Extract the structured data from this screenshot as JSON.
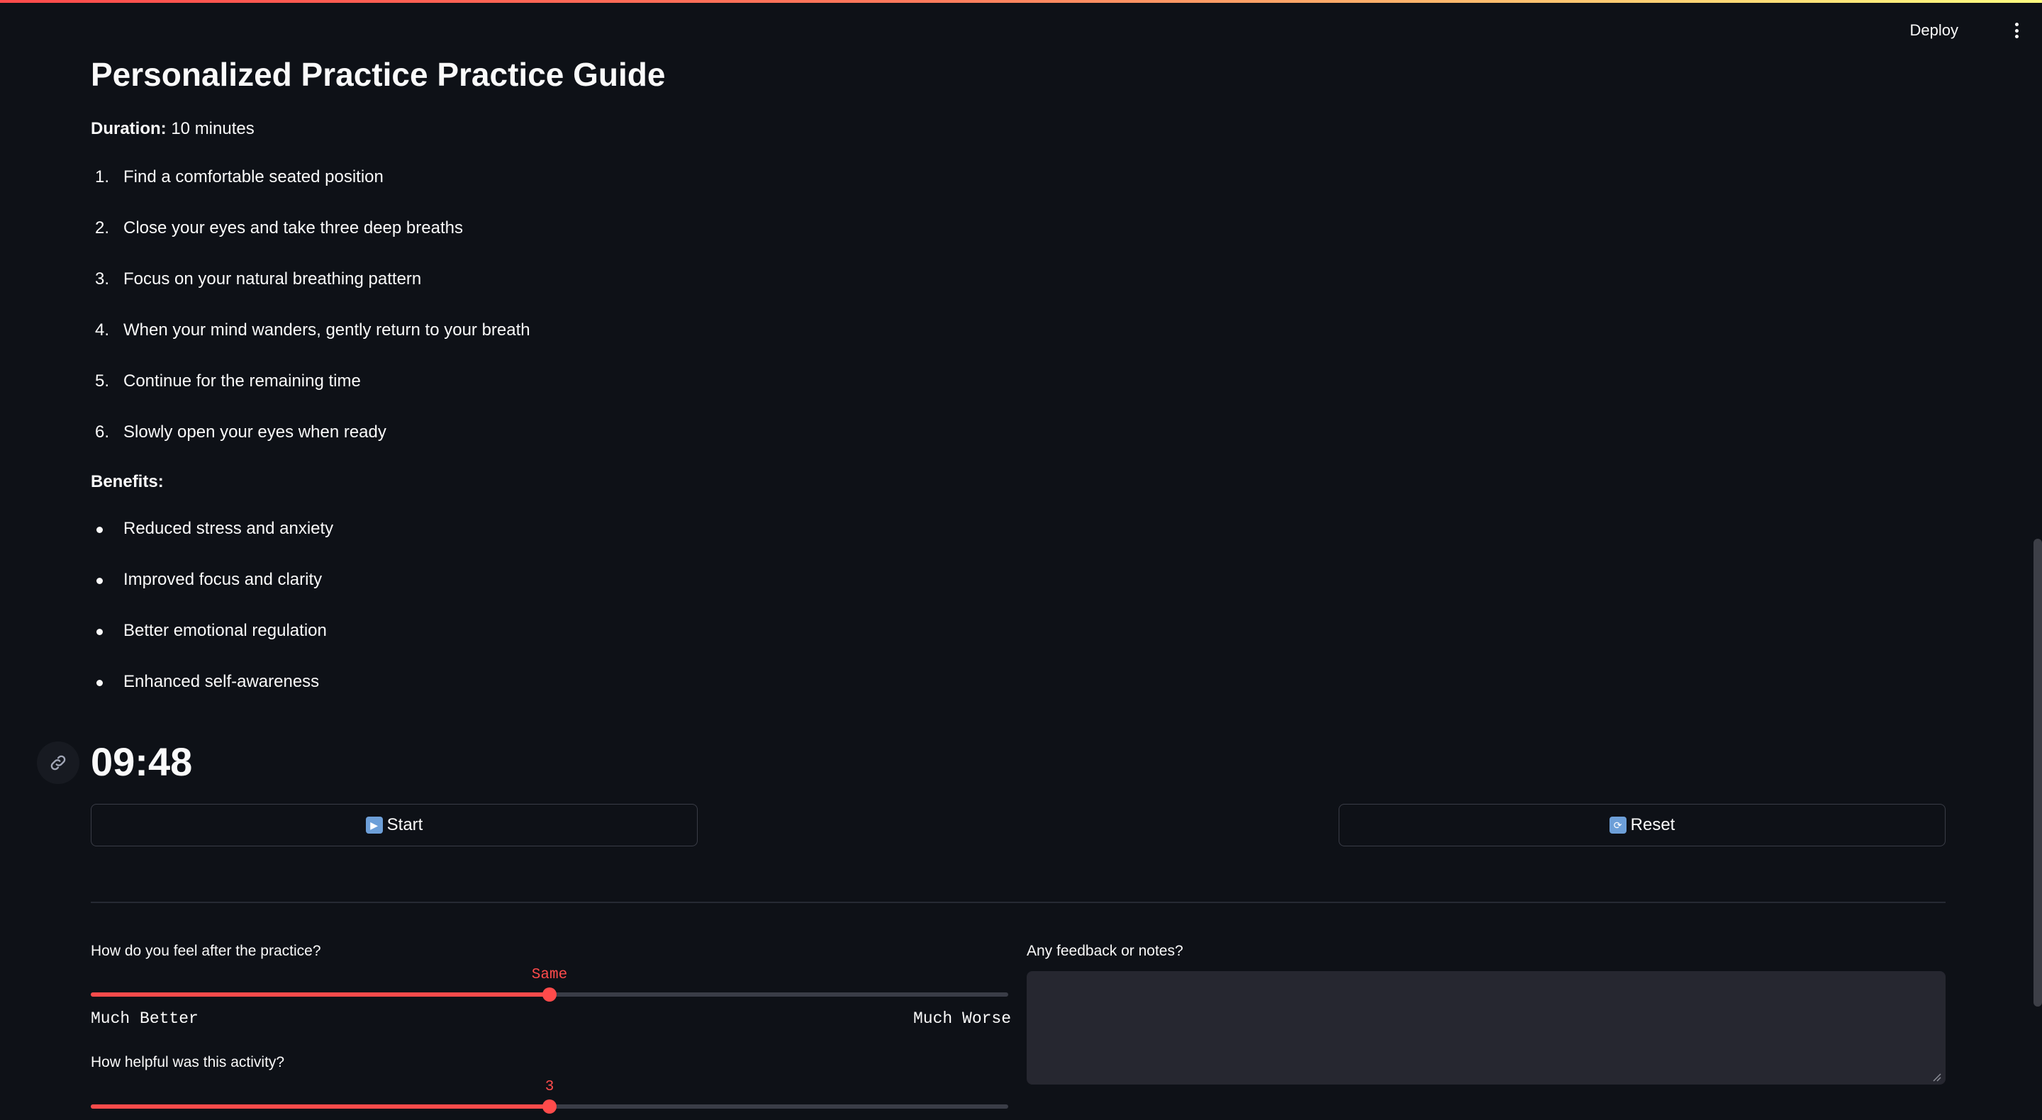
{
  "header": {
    "deploy_label": "Deploy",
    "menu_icon": "kebab-menu-icon"
  },
  "guide": {
    "title": "Personalized Practice Practice Guide",
    "duration_label": "Duration:",
    "duration_value": "10 minutes",
    "steps": [
      {
        "num": "1.",
        "text": "Find a comfortable seated position"
      },
      {
        "num": "2.",
        "text": "Close your eyes and take three deep breaths"
      },
      {
        "num": "3.",
        "text": "Focus on your natural breathing pattern"
      },
      {
        "num": "4.",
        "text": "When your mind wanders, gently return to your breath"
      },
      {
        "num": "5.",
        "text": "Continue for the remaining time"
      },
      {
        "num": "6.",
        "text": "Slowly open your eyes when ready"
      }
    ],
    "benefits_label": "Benefits:",
    "benefits": [
      "Reduced stress and anxiety",
      "Improved focus and clarity",
      "Better emotional regulation",
      "Enhanced self-awareness"
    ]
  },
  "timer": {
    "value": "09:48",
    "anchor_icon": "link-icon"
  },
  "controls": {
    "start_label": "Start",
    "start_icon": "play-icon",
    "reset_label": "Reset",
    "reset_icon": "arrows-cycle-icon"
  },
  "feedback": {
    "feeling_question": "How do you feel after the practice?",
    "feeling_value": "Same",
    "feeling_fraction": 0.5,
    "feeling_min": "Much Better",
    "feeling_max": "Much Worse",
    "helpful_question": "How helpful was this activity?",
    "helpful_value": "3",
    "helpful_fraction": 0.5,
    "notes_label": "Any feedback or notes?",
    "notes_value": ""
  },
  "colors": {
    "accent": "#ff4b4b",
    "background": "#0e1117",
    "text": "#fafafa"
  }
}
